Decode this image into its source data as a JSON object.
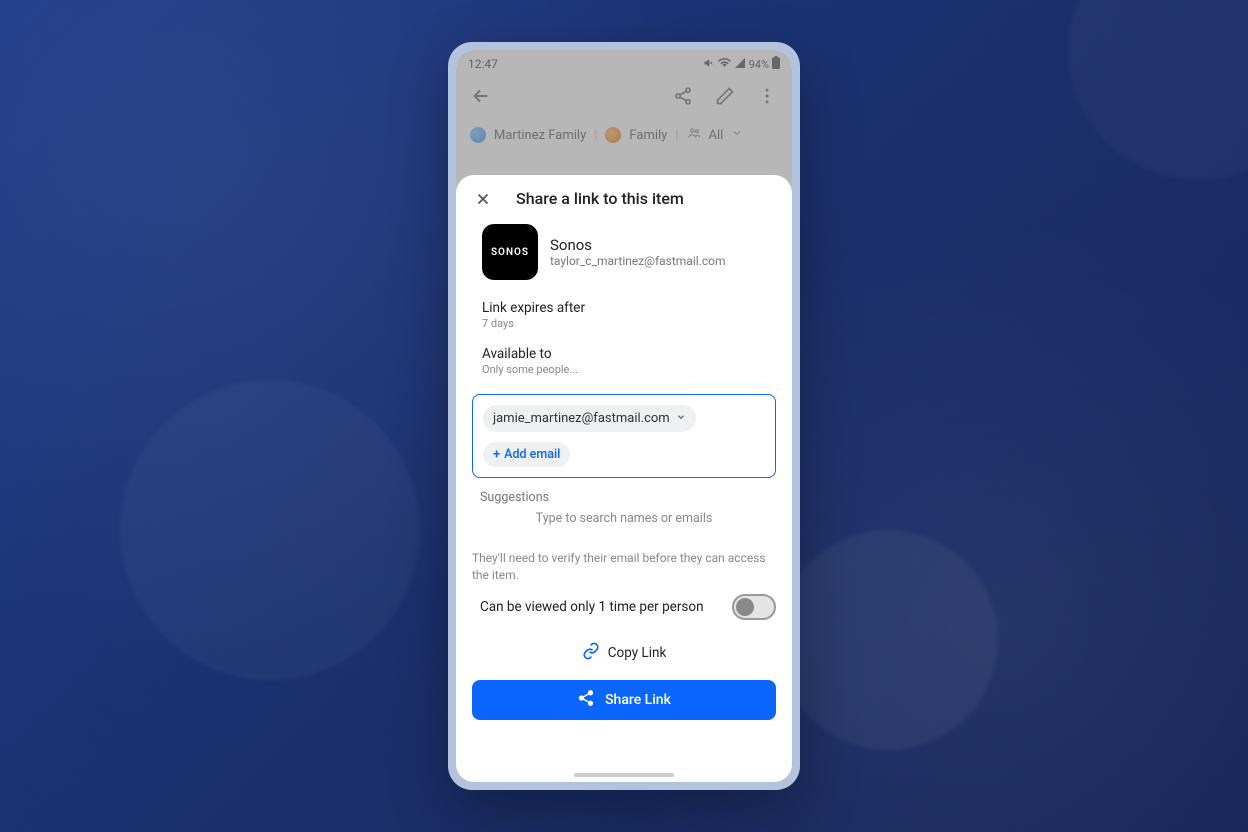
{
  "status": {
    "time": "12:47",
    "battery": "94%"
  },
  "topbar": {
    "back": "Back"
  },
  "breadcrumb": {
    "item1": "Martinez Family",
    "item2": "Family",
    "item3": "All"
  },
  "sheet": {
    "title": "Share a link to this item",
    "item": {
      "name": "Sonos",
      "logo_text": "SONOS",
      "subtitle": "taylor_c_martinez@fastmail.com"
    },
    "expires": {
      "label": "Link expires after",
      "value": "7 days"
    },
    "available": {
      "label": "Available to",
      "value": "Only some people..."
    },
    "emails": {
      "primary": "jamie_martinez@fastmail.com"
    },
    "add_email": "Add email",
    "suggestions": {
      "label": "Suggestions",
      "hint": "Type to search names or emails"
    },
    "verify_note": "They'll need to verify their email before they can access the item.",
    "toggle": {
      "label": "Can be viewed only 1 time per person"
    },
    "copy_link": "Copy Link",
    "share_button": "Share Link"
  }
}
